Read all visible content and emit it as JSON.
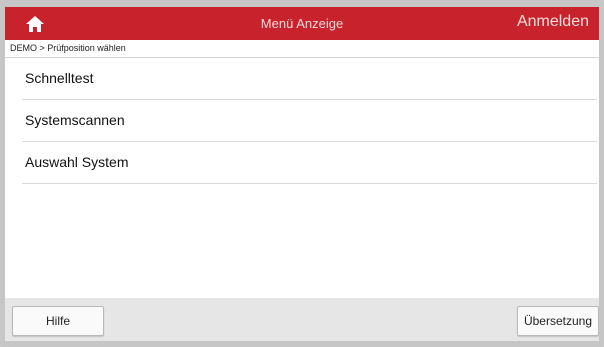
{
  "topbar": {
    "home_icon": "home-icon",
    "title": "Menü Anzeige",
    "login_label": "Anmelden",
    "color": "#c8232c"
  },
  "breadcrumb": {
    "text": "DEMO > Prüfposition wählen"
  },
  "menu": {
    "items": [
      {
        "label": "Schnelltest"
      },
      {
        "label": "Systemscannen"
      },
      {
        "label": "Auswahl System"
      }
    ]
  },
  "bottombar": {
    "help_label": "Hilfe",
    "translate_label": "Übersetzung"
  }
}
